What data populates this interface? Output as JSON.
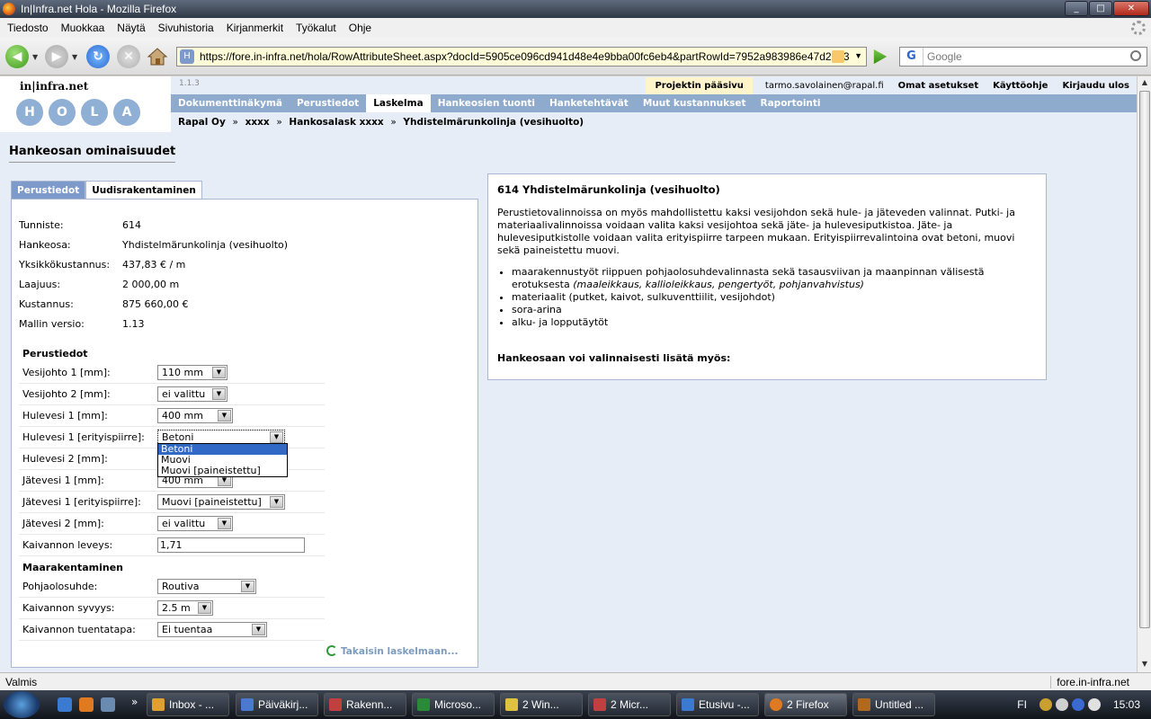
{
  "window": {
    "title": "In|Infra.net Hola - Mozilla Firefox",
    "min": "_",
    "max": "□",
    "close": "✕"
  },
  "menu": [
    "Tiedosto",
    "Muokkaa",
    "Näytä",
    "Sivuhistoria",
    "Kirjanmerkit",
    "Työkalut",
    "Ohje"
  ],
  "nav": {
    "url": "https://fore.in-infra.net/hola/RowAttributeSheet.aspx?docId=5905ce096cd941d48e4e9bba00fc6eb4&partRowId=7952a983986e47d2a33",
    "site_icon": "H",
    "search_engine": "G",
    "search_placeholder": "Google"
  },
  "app": {
    "brand": "in|infra.net",
    "logo_letters": [
      "H",
      "O",
      "L",
      "A"
    ],
    "version": "1.1.3",
    "home_tab": "Projektin pääsivu",
    "user": "tarmo.savolainen@rapal.fi",
    "top_links": [
      "Omat asetukset",
      "Käyttöohje",
      "Kirjaudu ulos"
    ],
    "tabs": [
      {
        "label": "Dokumenttinäkymä",
        "active": false
      },
      {
        "label": "Perustiedot",
        "active": false
      },
      {
        "label": "Laskelma",
        "active": true
      },
      {
        "label": "Hankeosien tuonti",
        "active": false
      },
      {
        "label": "Hanketehtävät",
        "active": false
      },
      {
        "label": "Muut kustannukset",
        "active": false
      },
      {
        "label": "Raportointi",
        "active": false
      }
    ],
    "breadcrumb": [
      "Rapal Oy",
      "xxxx",
      "Hankosalask xxxx",
      "Yhdistelmärunkolinja (vesihuolto)"
    ],
    "breadcrumb_sep": "»"
  },
  "page": {
    "title": "Hankeosan ominaisuudet",
    "tabs": [
      "Perustiedot",
      "Uudisrakentaminen"
    ],
    "info": [
      {
        "k": "Tunniste:",
        "v": "614"
      },
      {
        "k": "Hankeosa:",
        "v": "Yhdistelmärunkolinja (vesihuolto)"
      },
      {
        "k": "Yksikkökustannus:",
        "v": "437,83 € / m"
      },
      {
        "k": "Laajuus:",
        "v": "2 000,00 m"
      },
      {
        "k": "Kustannus:",
        "v": "875 660,00 €"
      },
      {
        "k": "Mallin versio:",
        "v": "1.13"
      }
    ],
    "section1": "Perustiedot",
    "fields1": [
      {
        "label": "Vesijohto 1 [mm]:",
        "value": "110 mm"
      },
      {
        "label": "Vesijohto 2 [mm]:",
        "value": "ei valittu"
      },
      {
        "label": "Hulevesi 1 [mm]:",
        "value": "400 mm"
      },
      {
        "label": "Hulevesi 1 [erityispiirre]:",
        "value": "Betoni"
      },
      {
        "label": "Hulevesi 2 [mm]:",
        "value": ""
      },
      {
        "label": "Jätevesi 1 [mm]:",
        "value": "400 mm"
      },
      {
        "label": "Jätevesi 1 [erityispiirre]:",
        "value": "Muovi [paineistettu]"
      },
      {
        "label": "Jätevesi 2 [mm]:",
        "value": "ei valittu"
      },
      {
        "label": "Kaivannon leveys:",
        "value": "1,71"
      }
    ],
    "section2": "Maarakentaminen",
    "fields2": [
      {
        "label": "Pohjaolosuhde:",
        "value": "Routiva"
      },
      {
        "label": "Kaivannon syvyys:",
        "value": "2.5 m"
      },
      {
        "label": "Kaivannon tuentatapa:",
        "value": "Ei tuentaa"
      }
    ],
    "dropdown_open": [
      "Betoni",
      "Muovi",
      "Muovi [paineistettu]"
    ],
    "back_link": "Takaisin laskelmaan..."
  },
  "desc": {
    "title": "614 Yhdistelmärunkolinja (vesihuolto)",
    "text": "Perustietovalinnoissa on myös mahdollistettu kaksi vesijohdon sekä hule- ja jäteveden valinnat. Putki- ja materiaalivalinnoissa voidaan valita kaksi vesijohtoa sekä jäte- ja hulevesiputkistoa. Jäte- ja hulevesiputkistolle voidaan valita erityispiirre tarpeen mukaan. Erityispiirrevalintoina ovat betoni, muovi sekä paineistettu muovi.",
    "bullet1": "maarakennustyöt riippuen pohjaolosuhdevalinnasta sekä tasausviivan ja maanpinnan välisestä erotuksesta",
    "bullet1_em": "(maaleikkaus, kallioleikkaus, pengertyöt, pohjanvahvistus)",
    "bullets": [
      "materiaalit (putket, kaivot, sulkuventtiilit, vesijohdot)",
      "sora-arina",
      "alku- ja lopputäytöt"
    ],
    "optional": "Hankeosaan voi valinnaisesti lisätä myös:"
  },
  "status": {
    "left": "Valmis",
    "right": "fore.in-infra.net"
  },
  "taskbar": {
    "tasks": [
      "Inbox - ...",
      "Päiväkirj...",
      "Rakenn...",
      "Microso...",
      "2 Win...",
      "2 Micr...",
      "Etusivu -...",
      "2 Firefox",
      "Untitled ..."
    ],
    "overflow": "»",
    "lang": "FI",
    "clock": "15:03"
  },
  "colors": {
    "tab_bar": "#8eaacd",
    "panel_border": "#a8b8d0",
    "page_bg": "#e7edf6",
    "highlight": "#3169c6"
  }
}
